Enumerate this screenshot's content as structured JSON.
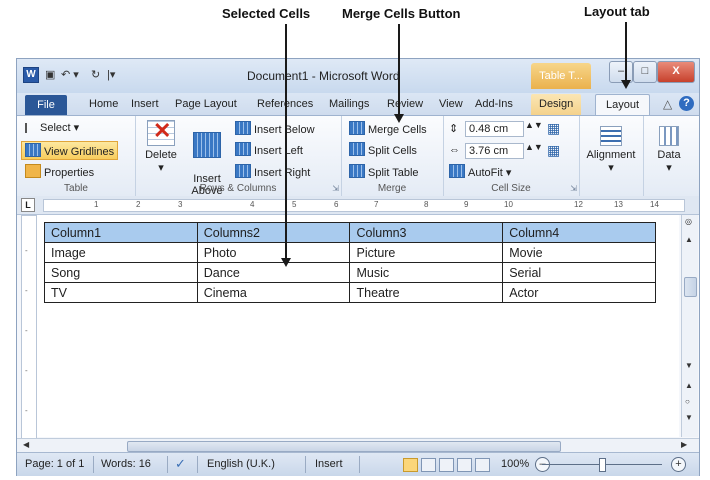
{
  "annotations": {
    "selected_cells": "Selected Cells",
    "merge_cells_button": "Merge Cells Button",
    "layout_tab": "Layout tab"
  },
  "titlebar": {
    "app_icon": "W",
    "title": "Document1 - Microsoft Word",
    "context_tab": "Table T...",
    "min": "–",
    "max": "□",
    "close": "X"
  },
  "tabs": [
    "Home",
    "Insert",
    "Page Layout",
    "References",
    "Mailings",
    "Review",
    "View",
    "Add-Ins",
    "Design",
    "Layout"
  ],
  "file_tab": "File",
  "ribbon": {
    "table": {
      "select": "Select",
      "view_gridlines": "View Gridlines",
      "properties": "Properties",
      "label": "Table"
    },
    "rows_columns": {
      "delete": "Delete",
      "insert_above": "Insert\nAbove",
      "insert_below": "Insert Below",
      "insert_left": "Insert Left",
      "insert_right": "Insert Right",
      "label": "Rows & Columns"
    },
    "merge": {
      "merge_cells": "Merge Cells",
      "split_cells": "Split Cells",
      "split_table": "Split Table",
      "label": "Merge"
    },
    "cell_size": {
      "height": "0.48 cm",
      "width": "3.76 cm",
      "autofit": "AutoFit",
      "label": "Cell Size"
    },
    "alignment": "Alignment",
    "data": "Data"
  },
  "table": {
    "rows": [
      [
        "Column1",
        "Columns2",
        "Column3",
        "Column4"
      ],
      [
        "Image",
        "Photo",
        "Picture",
        "Movie"
      ],
      [
        "Song",
        "Dance",
        "Music",
        "Serial"
      ],
      [
        "TV",
        "Cinema",
        "Theatre",
        "Actor"
      ]
    ],
    "selected_row": 0
  },
  "statusbar": {
    "page": "Page: 1 of 1",
    "words": "Words: 16",
    "language": "English (U.K.)",
    "mode": "Insert",
    "zoom": "100%",
    "zoom_out": "–",
    "zoom_in": "+"
  },
  "colors": {
    "selection": "#a9cbee",
    "file_tab": "#2b5797",
    "context_tab": "#eab14d"
  }
}
